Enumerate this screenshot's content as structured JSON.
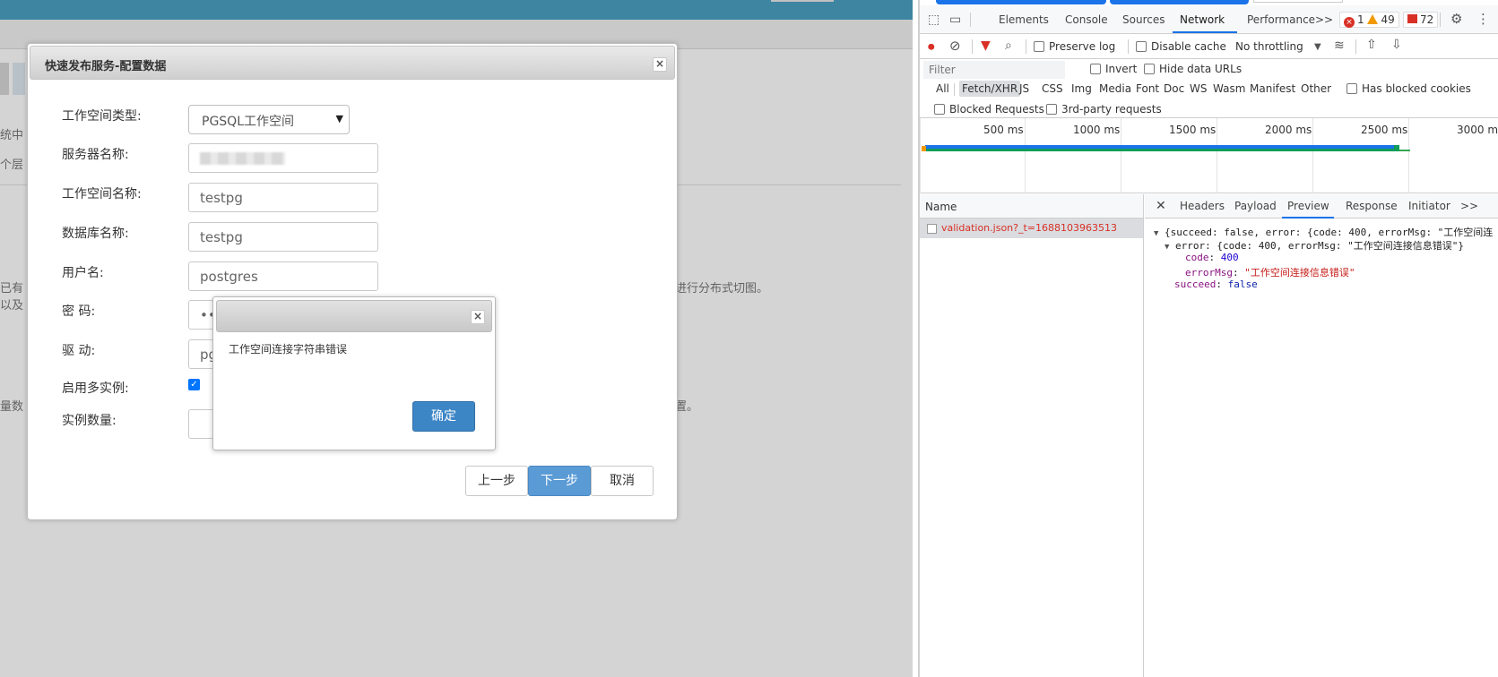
{
  "app": {
    "bg_fragments": [
      "统中",
      "个层",
      "已有",
      "以及",
      "量数",
      "进行分布式切图。",
      "置。"
    ],
    "dialog": {
      "title": "快速发布服务-配置数据",
      "close_glyph": "×",
      "fields": [
        {
          "label": "工作空间类型:",
          "type": "select",
          "value": "PGSQL工作空间"
        },
        {
          "label": "服务器名称:",
          "type": "text",
          "value": ""
        },
        {
          "label": "工作空间名称:",
          "type": "text",
          "value": "testpg"
        },
        {
          "label": "数据库名称:",
          "type": "text",
          "value": "testpg"
        },
        {
          "label": "用户名:",
          "type": "text",
          "value": "postgres"
        },
        {
          "label": "密 码:",
          "type": "password",
          "value": "••"
        },
        {
          "label": "驱 动:",
          "type": "text",
          "value": "pg"
        },
        {
          "label": "启用多实例:",
          "type": "checkbox",
          "checked": true
        },
        {
          "label": "实例数量:",
          "type": "text",
          "value": ""
        }
      ],
      "buttons": {
        "prev": "上一步",
        "next": "下一步",
        "cancel": "取消"
      }
    },
    "alert": {
      "message": "工作空间连接字符串错误",
      "ok": "确定",
      "close_glyph": "×"
    }
  },
  "devtools": {
    "tabs": [
      "Elements",
      "Console",
      "Sources",
      "Network",
      "Performance"
    ],
    "active_tab": "Network",
    "more": ">>",
    "counts": {
      "errors": "1",
      "warnings": "49",
      "issues": "72"
    },
    "toolbar": {
      "preserve_log": "Preserve log",
      "disable_cache": "Disable cache",
      "throttling": "No throttling"
    },
    "filter": {
      "placeholder": "Filter",
      "invert": "Invert",
      "hide_data_urls": "Hide data URLs",
      "types": [
        "All",
        "Fetch/XHR",
        "JS",
        "CSS",
        "Img",
        "Media",
        "Font",
        "Doc",
        "WS",
        "Wasm",
        "Manifest",
        "Other"
      ],
      "active_type": "Fetch/XHR",
      "has_blocked_cookies": "Has blocked cookies",
      "blocked_requests": "Blocked Requests",
      "third_party": "3rd-party requests"
    },
    "timeline": {
      "ticks": [
        "500 ms",
        "1000 ms",
        "1500 ms",
        "2000 ms",
        "2500 ms",
        "3000 m"
      ]
    },
    "name_panel": {
      "header": "Name",
      "requests": [
        "validation.json?_t=1688103963513"
      ]
    },
    "detail": {
      "close": "✕",
      "tabs": [
        "Headers",
        "Payload",
        "Preview",
        "Response",
        "Initiator"
      ],
      "active_tab": "Preview",
      "more": ">>",
      "preview": {
        "line1": "{succeed: false, error: {code: 400, errorMsg: \"工作空间连",
        "line2": "error: {code: 400, errorMsg: \"工作空间连接信息错误\"}",
        "code_key": "code",
        "code_val": "400",
        "msg_key": "errorMsg",
        "msg_val": "\"工作空间连接信息错误\"",
        "succeed_key": "succeed",
        "succeed_val": "false"
      }
    }
  }
}
